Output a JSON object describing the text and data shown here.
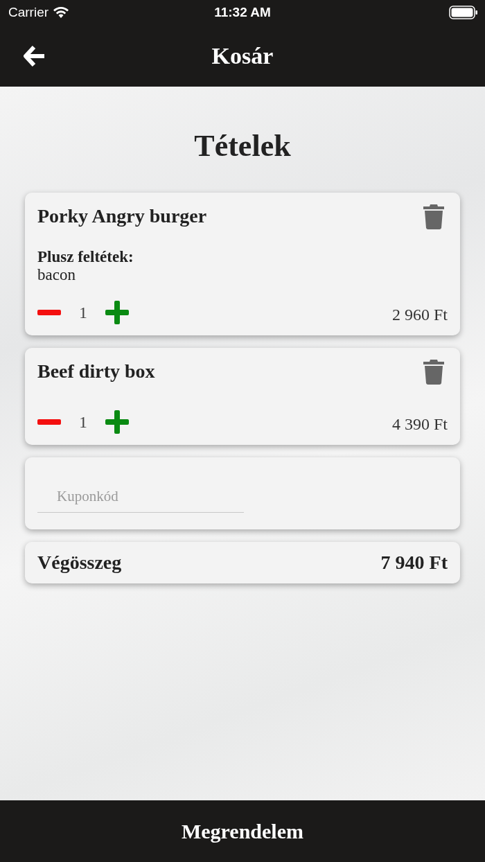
{
  "status_bar": {
    "carrier": "Carrier",
    "time": "11:32 AM"
  },
  "nav": {
    "title": "Kosár"
  },
  "heading": "Tételek",
  "items": [
    {
      "name": "Porky Angry burger",
      "extras_label": "Plusz feltétek:",
      "extras": "bacon",
      "quantity": "1",
      "price": "2 960 Ft"
    },
    {
      "name": "Beef dirty box",
      "quantity": "1",
      "price": "4 390 Ft"
    }
  ],
  "coupon": {
    "placeholder": "Kuponkód"
  },
  "total": {
    "label": "Végösszeg",
    "value": "7 940 Ft"
  },
  "order_button": "Megrendelem"
}
